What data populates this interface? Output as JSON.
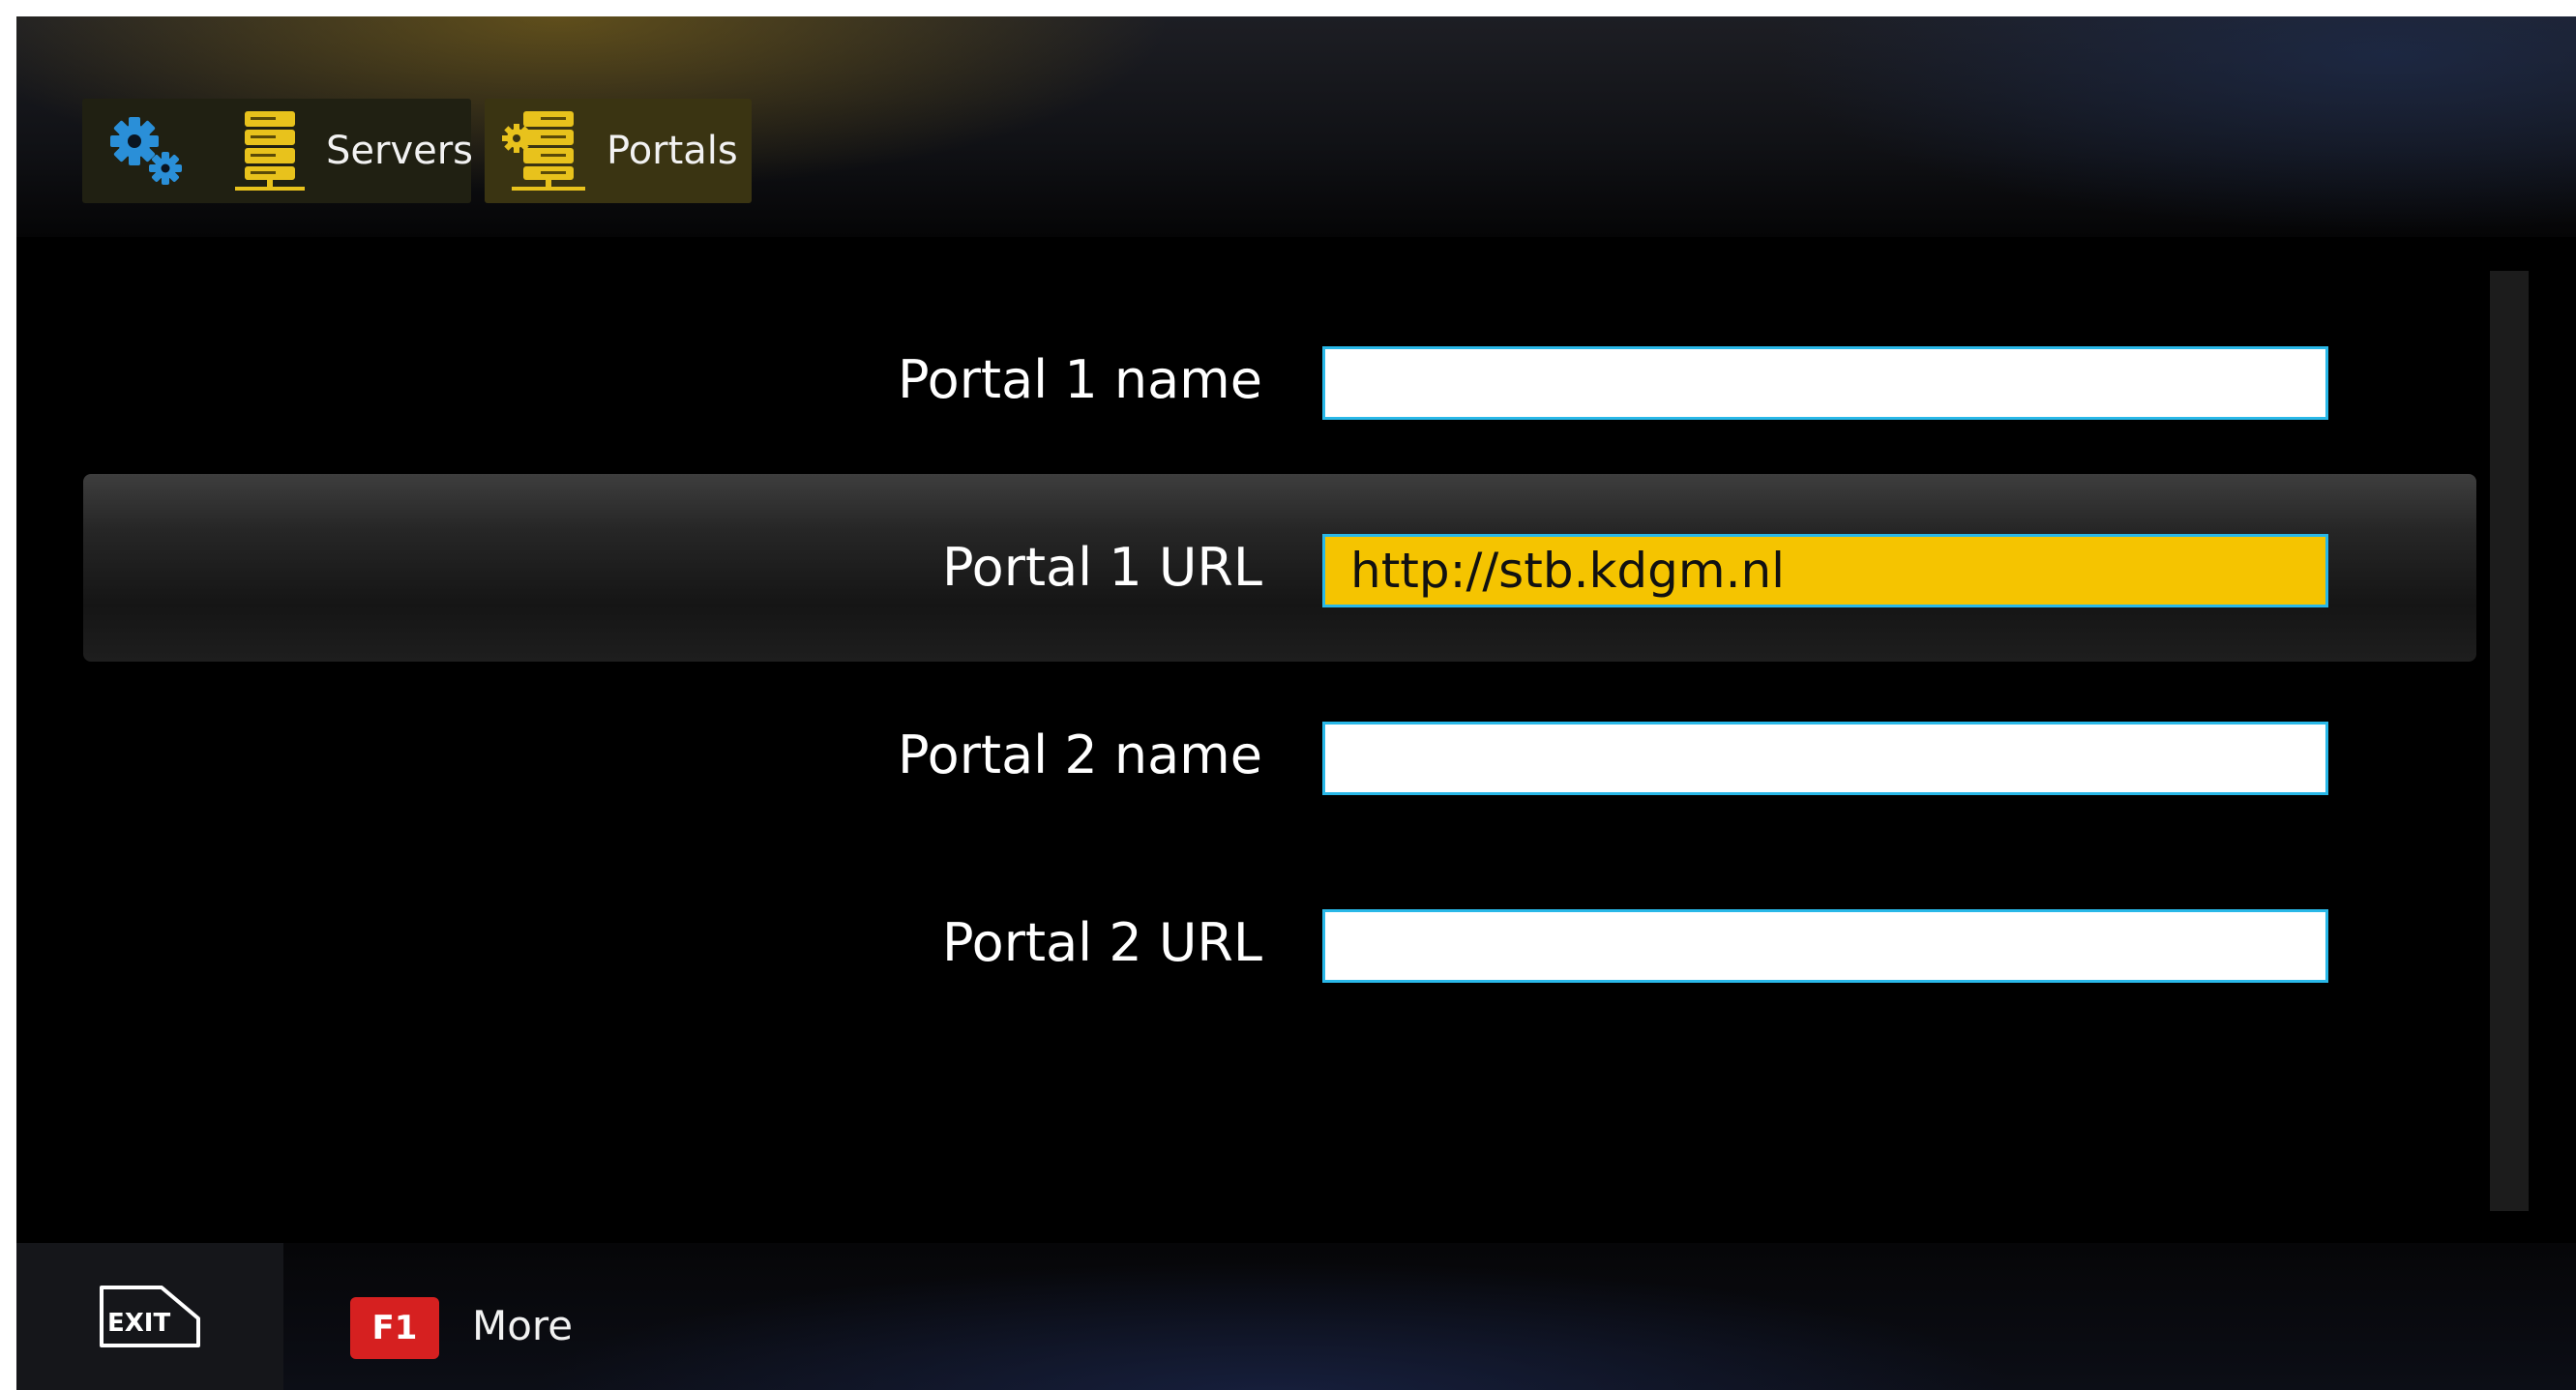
{
  "tabs": [
    {
      "id": "settings",
      "icon": "gears-icon",
      "label": ""
    },
    {
      "id": "servers",
      "icon": "server-stack-icon",
      "label": "Servers"
    },
    {
      "id": "portals",
      "icon": "server-gear-icon",
      "label": "Portals"
    }
  ],
  "active_tab": "Portals",
  "form": {
    "rows": [
      {
        "label": "Portal 1 name",
        "value": ""
      },
      {
        "label": "Portal 1 URL",
        "value": "http://stb.kdgm.nl"
      },
      {
        "label": "Portal 2 name",
        "value": ""
      },
      {
        "label": "Portal 2 URL",
        "value": ""
      }
    ],
    "selected_row": 1
  },
  "footer": {
    "exit_label": "EXIT",
    "f1_key": "F1",
    "more_label": "More"
  },
  "colors": {
    "accent_yellow": "#f5c400",
    "field_border": "#29b8e8",
    "tab_icon_yellow": "#e8c21c",
    "gear_blue": "#2a8fd8",
    "f1_red": "#d62020"
  }
}
